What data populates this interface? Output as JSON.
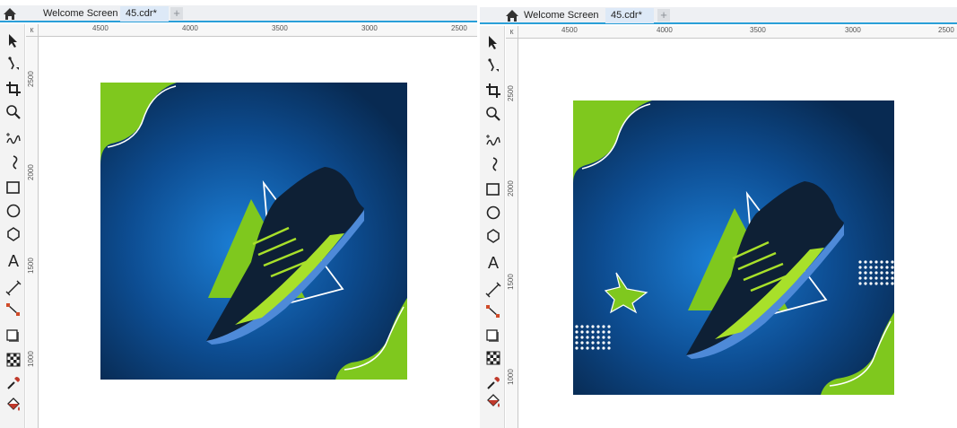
{
  "colors": {
    "tab_accent": "#2a9fd8",
    "bg_dark_blue": "#0b2f57",
    "bg_glow_blue": "#1c7fd6",
    "lime_green": "#7fc81e",
    "shoe_dark": "#0e2035",
    "shoe_blue": "#4e8ad8",
    "shoe_lime": "#a8e02a"
  },
  "panes": [
    {
      "tabs": {
        "home_icon": "home-icon",
        "welcome_label": "Welcome Screen",
        "document_label": "45.cdr*",
        "add_label": "+"
      },
      "ruler": {
        "corner_label": "к",
        "h_labels": [
          "4500",
          "4000",
          "3500",
          "3000",
          "2500"
        ],
        "v_labels": [
          "2500",
          "2000",
          "1500",
          "1000"
        ]
      },
      "toolbox_icons": [
        "pick-tool-icon",
        "shape-tool-icon",
        "crop-tool-icon",
        "zoom-tool-icon",
        "freehand-tool-icon",
        "artistic-media-icon",
        "rectangle-tool-icon",
        "ellipse-tool-icon",
        "polygon-tool-icon",
        "text-tool-icon",
        "parallel-dimension-icon",
        "connector-tool-icon",
        "drop-shadow-icon",
        "transparency-icon",
        "eyedropper-icon",
        "interactive-fill-icon"
      ]
    },
    {
      "tabs": {
        "home_icon": "home-icon",
        "welcome_label": "Welcome Screen",
        "document_label": "45.cdr*",
        "add_label": "+"
      },
      "ruler": {
        "corner_label": "к",
        "h_labels": [
          "4500",
          "4000",
          "3500",
          "3000",
          "2500"
        ],
        "v_labels": [
          "2500",
          "2000",
          "1500",
          "1000"
        ]
      },
      "toolbox_icons": [
        "pick-tool-icon",
        "shape-tool-icon",
        "crop-tool-icon",
        "zoom-tool-icon",
        "freehand-tool-icon",
        "artistic-media-icon",
        "rectangle-tool-icon",
        "ellipse-tool-icon",
        "polygon-tool-icon",
        "text-tool-icon",
        "parallel-dimension-icon",
        "connector-tool-icon",
        "drop-shadow-icon",
        "transparency-icon",
        "eyedropper-icon",
        "interactive-fill-icon"
      ]
    }
  ],
  "text_tool_glyph": "A"
}
